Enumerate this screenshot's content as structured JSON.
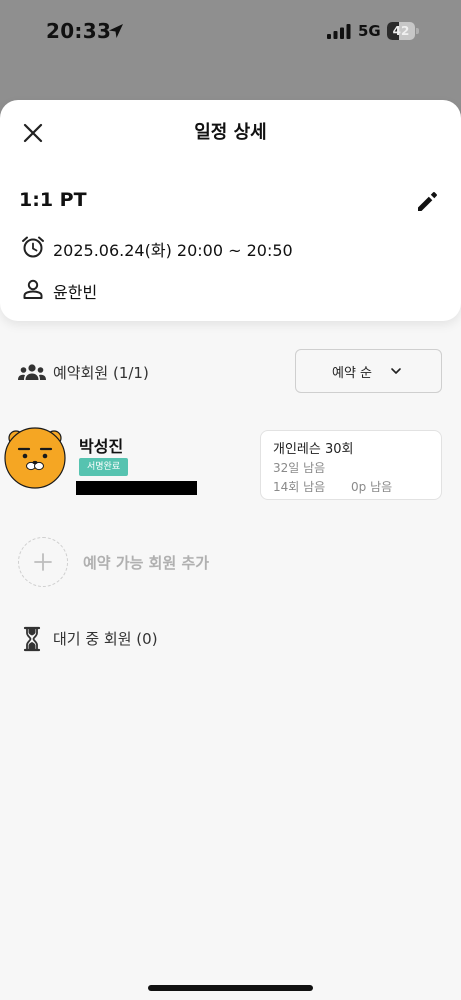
{
  "status_bar": {
    "time": "20:33",
    "network": "5G",
    "battery": "42",
    "battery_level": 0.42
  },
  "sheet": {
    "title": "일정 상세",
    "session_type": "1:1 PT",
    "datetime": "2025.06.24(화) 20:00 ~ 20:50",
    "trainer": "윤한빈"
  },
  "reservations": {
    "label": "예약회원 (1/1)",
    "sort": {
      "selected": "예약 순"
    },
    "members": [
      {
        "name": "박성진",
        "badge": "서명완료",
        "ticket": {
          "name": "개인레슨 30회",
          "days_left": "32일 남음",
          "sessions_left": "14회 남음",
          "points_left": "0p 남음"
        }
      }
    ]
  },
  "add_member_label": "예약 가능 회원 추가",
  "waiting_label": "대기 중 회원 (0)",
  "colors": {
    "accent_badge": "#56c3b0",
    "avatar": "#f5a623",
    "dim_overlay": "#8f8f8f"
  }
}
